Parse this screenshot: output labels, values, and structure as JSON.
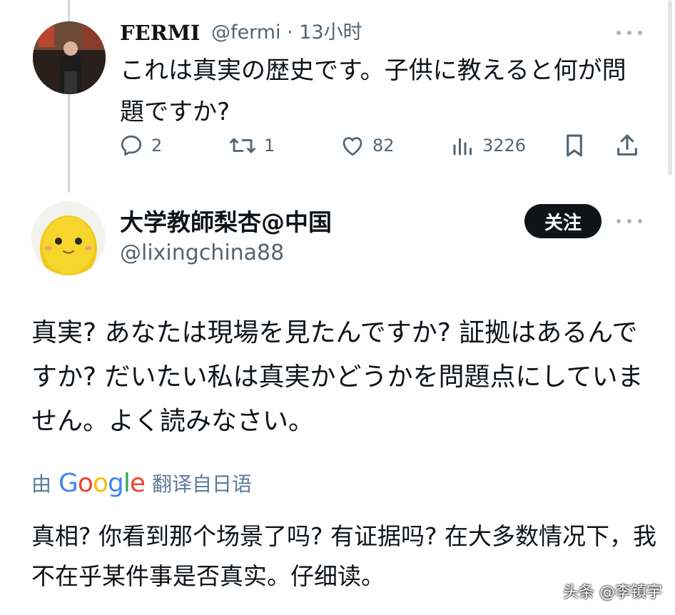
{
  "tweet1": {
    "name": "FERMI",
    "handle": "@fermi",
    "time": "13小时",
    "text": "これは真実の歴史です。子供に教えると何が問題ですか?",
    "actions": {
      "replies": "2",
      "retweets": "1",
      "likes": "82",
      "views": "3226"
    }
  },
  "tweet2": {
    "name": "大学教師梨杏@中国",
    "handle": "@lixingchina88",
    "follow_label": "关注",
    "text": "真実? あなたは現場を見たんですか? 証拠はあるんですか? だいたい私は真実かどうかを問題点にしていません。よく読みなさい。",
    "translate_prefix": "由",
    "translate_brand": "Google",
    "translate_suffix": "翻译自日语",
    "translated_text": "真相? 你看到那个场景了吗? 有证据吗? 在大多数情况下，我不在乎某件事是否真实。仔细读。"
  },
  "watermark": "头条 @李镇宇",
  "colors": {
    "text": "#0f1419",
    "secondary": "#536471",
    "button_bg": "#0f1419",
    "translate": "#5b7b9b",
    "google_blue": "#4285f4",
    "google_red": "#ea4335",
    "google_yellow": "#fbbc05",
    "google_green": "#34a853"
  }
}
